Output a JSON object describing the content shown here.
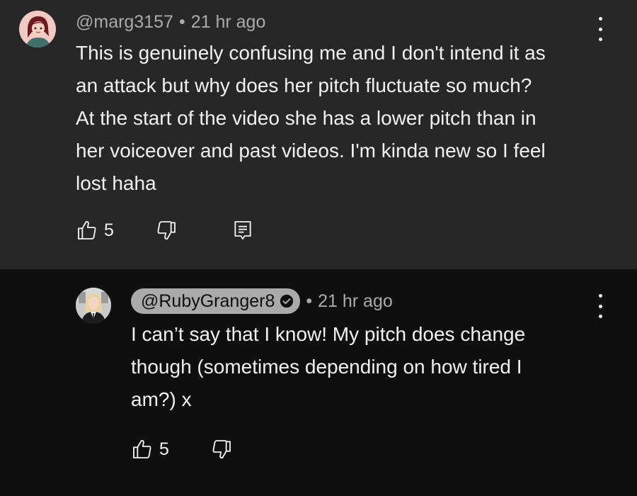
{
  "comments": [
    {
      "handle": "@marg3157",
      "separator": "•",
      "time": "21 hr ago",
      "text_lines": [
        "This is genuinely confusing me and I don't intend it as",
        "an attack but why does her pitch fluctuate so much?",
        "At the start of the video she has a lower pitch than in",
        "her voiceover and past videos. I'm kinda new so I feel",
        "lost haha"
      ],
      "like_count": "5",
      "icons": {
        "avatar": "avatar-cartoon-girl",
        "like": "thumbs-up-icon",
        "dislike": "thumbs-down-icon",
        "reply": "reply-comment-icon",
        "menu": "more-vertical-icon"
      }
    },
    {
      "handle": "@RubyGranger8",
      "verified": true,
      "separator": "•",
      "time": "21 hr ago",
      "text_lines": [
        "I can’t say that I know! My pitch does change",
        "though (sometimes depending on how tired I",
        "am?) x"
      ],
      "like_count": "5",
      "icons": {
        "avatar": "avatar-photo",
        "verified": "verified-check-icon",
        "like": "thumbs-up-icon",
        "dislike": "thumbs-down-icon",
        "menu": "more-vertical-icon"
      }
    }
  ],
  "colors": {
    "top_comment_bg": "#272727",
    "reply_bg": "#0f0f0f",
    "text": "#f1f1f1",
    "meta": "#aaaaaa",
    "creator_pill": "#aaaaaa"
  }
}
